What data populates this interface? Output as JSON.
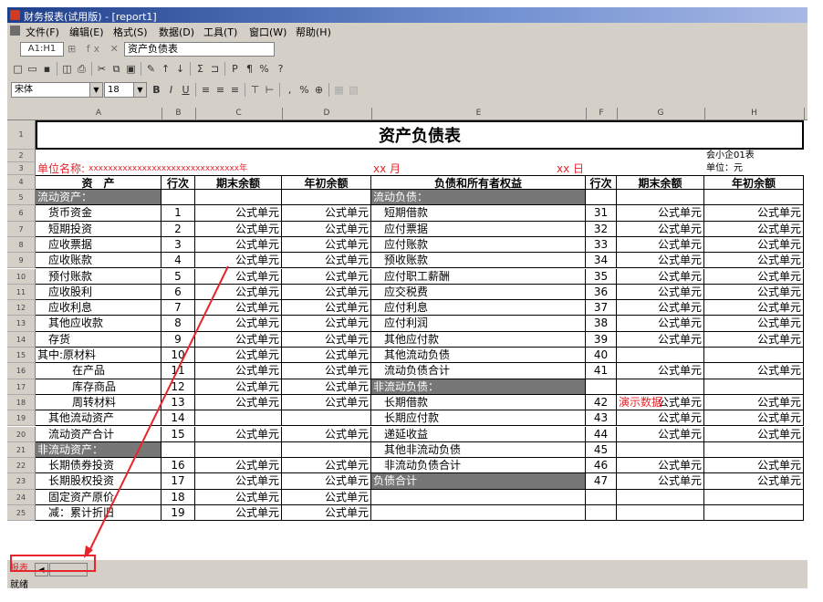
{
  "window": {
    "title": "财务报表(试用版) - [report1]"
  },
  "menu": [
    "文件(F)",
    "编辑(E)",
    "格式(S)",
    "数据(D)",
    "工具(T)",
    "窗口(W)",
    "帮助(H)"
  ],
  "formula_bar": {
    "cell_ref": "A1:H1",
    "icons": "⊞ fx ✕ ✓",
    "content": "资产负债表"
  },
  "toolbar": {
    "font_name": "宋体",
    "font_size": "18",
    "bold": "B",
    "italic": "I",
    "underline": "U",
    "currency": "%",
    "percent_icon": "％"
  },
  "sheet": {
    "columns": [
      "A",
      "B",
      "C",
      "D",
      "E",
      "F",
      "G",
      "H"
    ],
    "title": "资产负债表",
    "form_no": "会小企01表",
    "unit": "单位：元",
    "company_label": "单位名称:",
    "company_mask": "xxxxxxxxxxxxxxxxxxxxxxxxxxxxxxx年",
    "month": "xx 月",
    "day": "xx 日",
    "headers": {
      "asset": "资　产",
      "row_no": "行次",
      "end_balance": "期末余额",
      "begin_balance": "年初余额",
      "liability": "负债和所有者权益",
      "row_no2": "行次",
      "end_balance2": "期末余额",
      "begin_balance2": "年初余额"
    },
    "demo_label": "演示数据",
    "rows": [
      {
        "n": "5",
        "a": "流动资产：",
        "b": "",
        "c": "",
        "d": "",
        "e": "流动负债：",
        "f": "",
        "g": "",
        "h": "",
        "ahl": true,
        "ehl": true
      },
      {
        "n": "6",
        "a": "货币资金",
        "b": "1",
        "c": "公式单元",
        "d": "公式单元",
        "e": "短期借款",
        "f": "31",
        "g": "公式单元",
        "h": "公式单元"
      },
      {
        "n": "7",
        "a": "短期投资",
        "b": "2",
        "c": "公式单元",
        "d": "公式单元",
        "e": "应付票据",
        "f": "32",
        "g": "公式单元",
        "h": "公式单元"
      },
      {
        "n": "8",
        "a": "应收票据",
        "b": "3",
        "c": "公式单元",
        "d": "公式单元",
        "e": "应付账款",
        "f": "33",
        "g": "公式单元",
        "h": "公式单元"
      },
      {
        "n": "9",
        "a": "应收账款",
        "b": "4",
        "c": "公式单元",
        "d": "公式单元",
        "e": "预收账款",
        "f": "34",
        "g": "公式单元",
        "h": "公式单元"
      },
      {
        "n": "10",
        "a": "预付账款",
        "b": "5",
        "c": "公式单元",
        "d": "公式单元",
        "e": "应付职工薪酬",
        "f": "35",
        "g": "公式单元",
        "h": "公式单元"
      },
      {
        "n": "11",
        "a": "应收股利",
        "b": "6",
        "c": "公式单元",
        "d": "公式单元",
        "e": "应交税费",
        "f": "36",
        "g": "公式单元",
        "h": "公式单元"
      },
      {
        "n": "12",
        "a": "应收利息",
        "b": "7",
        "c": "公式单元",
        "d": "公式单元",
        "e": "应付利息",
        "f": "37",
        "g": "公式单元",
        "h": "公式单元"
      },
      {
        "n": "13",
        "a": "其他应收款",
        "b": "8",
        "c": "公式单元",
        "d": "公式单元",
        "e": "应付利润",
        "f": "38",
        "g": "公式单元",
        "h": "公式单元"
      },
      {
        "n": "14",
        "a": "存货",
        "b": "9",
        "c": "公式单元",
        "d": "公式单元",
        "e": "其他应付款",
        "f": "39",
        "g": "公式单元",
        "h": "公式单元"
      },
      {
        "n": "15",
        "a": "其中:原材料",
        "b": "10",
        "c": "公式单元",
        "d": "公式单元",
        "e": "其他流动负债",
        "f": "40",
        "g": "",
        "h": ""
      },
      {
        "n": "16",
        "a": "在产品",
        "b": "11",
        "c": "公式单元",
        "d": "公式单元",
        "e": "流动负债合计",
        "f": "41",
        "g": "公式单元",
        "h": "公式单元"
      },
      {
        "n": "17",
        "a": "库存商品",
        "b": "12",
        "c": "公式单元",
        "d": "公式单元",
        "e": "非流动负债：",
        "f": "",
        "g": "",
        "h": "",
        "ehl": true
      },
      {
        "n": "18",
        "a": "周转材料",
        "b": "13",
        "c": "公式单元",
        "d": "公式单元",
        "e": "长期借款",
        "f": "42",
        "g": "公式单元",
        "h": "公式单元"
      },
      {
        "n": "19",
        "a": "其他流动资产",
        "b": "14",
        "c": "",
        "d": "",
        "e": "长期应付款",
        "f": "43",
        "g": "公式单元",
        "h": "公式单元"
      },
      {
        "n": "20",
        "a": "流动资产合计",
        "b": "15",
        "c": "公式单元",
        "d": "公式单元",
        "e": "递延收益",
        "f": "44",
        "g": "公式单元",
        "h": "公式单元"
      },
      {
        "n": "21",
        "a": "非流动资产：",
        "b": "",
        "c": "",
        "d": "",
        "e": "其他非流动负债",
        "f": "45",
        "g": "",
        "h": "",
        "ahl": true
      },
      {
        "n": "22",
        "a": "长期债券投资",
        "b": "16",
        "c": "公式单元",
        "d": "公式单元",
        "e": "非流动负债合计",
        "f": "46",
        "g": "公式单元",
        "h": "公式单元"
      },
      {
        "n": "23",
        "a": "长期股权投资",
        "b": "17",
        "c": "公式单元",
        "d": "公式单元",
        "e": "负债合计",
        "f": "47",
        "g": "公式单元",
        "h": "公式单元",
        "ehl": true
      },
      {
        "n": "24",
        "a": "固定资产原价",
        "b": "18",
        "c": "公式单元",
        "d": "公式单元",
        "e": "",
        "f": "",
        "g": "",
        "h": ""
      },
      {
        "n": "25",
        "a": "减：累计折旧",
        "b": "19",
        "c": "公式单元",
        "d": "公式单元",
        "e": "",
        "f": "",
        "g": "",
        "h": ""
      }
    ]
  },
  "status": {
    "sheet_tab": "报表",
    "status_text": "就绪"
  }
}
